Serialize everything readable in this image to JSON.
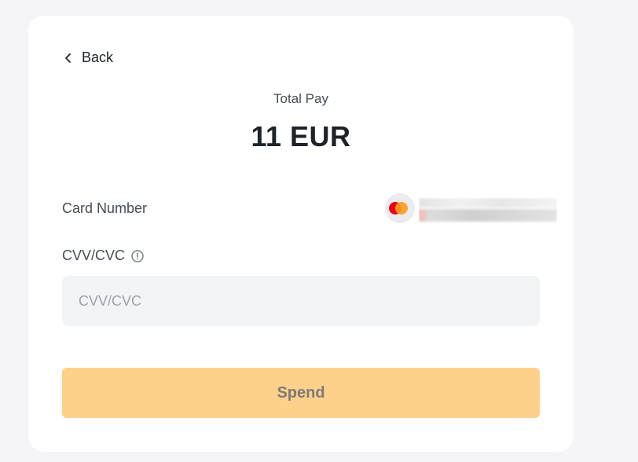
{
  "nav": {
    "back_label": "Back"
  },
  "payment": {
    "total_label": "Total Pay",
    "total_amount": "11 EUR"
  },
  "card": {
    "number_label": "Card Number",
    "brand_icon": "mastercard-icon"
  },
  "cvv": {
    "label": "CVV/CVC",
    "placeholder": "CVV/CVC",
    "value": "",
    "info_icon": "info-circle-icon"
  },
  "actions": {
    "spend_label": "Spend"
  },
  "colors": {
    "page_background": "#f5f5f7",
    "card_background": "#ffffff",
    "input_background": "#f3f4f6",
    "button_disabled": "#fdd18c",
    "text_primary": "#1e2329",
    "text_secondary": "#474d57"
  }
}
